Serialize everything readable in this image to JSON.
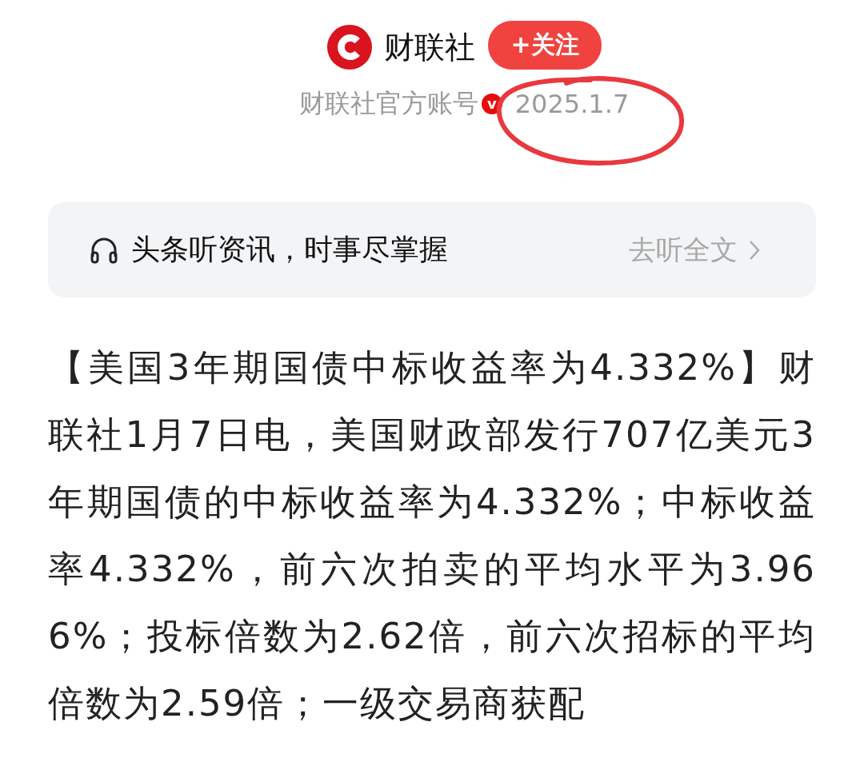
{
  "header": {
    "name": "财联社",
    "follow_button": "+关注",
    "subtitle": "财联社官方账号",
    "verified": true,
    "verified_mark": "v",
    "date": "2025.1.7"
  },
  "listen_bar": {
    "text": "头条听资讯，时事尽掌握",
    "action": "去听全文"
  },
  "article": {
    "paragraph": "【美国3年期国债中标收益率为4.332%】财联社1月7日电，美国财政部发行707亿美元3年期国债的中标收益率为4.332%；中标收益率4.332%，前六次拍卖的平均水平为3.966%；投标倍数为2.62倍，前六次招标的平均倍数为2.59倍；一级交易商获配"
  }
}
